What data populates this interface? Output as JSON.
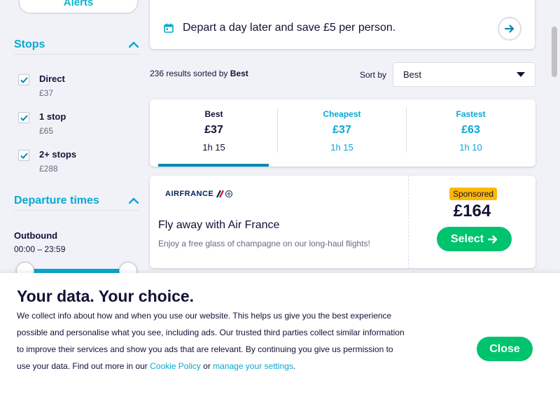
{
  "sidebar": {
    "alerts_label": "Alerts",
    "stops": {
      "heading": "Stops",
      "items": [
        {
          "label": "Direct",
          "price": "£37",
          "checked": true
        },
        {
          "label": "1 stop",
          "price": "£65",
          "checked": true
        },
        {
          "label": "2+ stops",
          "price": "£288",
          "checked": true
        }
      ]
    },
    "departure": {
      "heading": "Departure times",
      "outbound_label": "Outbound",
      "outbound_range": "00:00 – 23:59",
      "slider_range_fraction": [
        0,
        1
      ]
    }
  },
  "tip": {
    "text": "Depart a day later and save £5 per person."
  },
  "results": {
    "count_text": "236 results sorted by",
    "sorted_by": "Best",
    "sort_label": "Sort by",
    "sort_value": "Best"
  },
  "tabs": [
    {
      "name": "Best",
      "price": "£37",
      "duration": "1h 15",
      "active": true
    },
    {
      "name": "Cheapest",
      "price": "£37",
      "duration": "1h 15",
      "active": false
    },
    {
      "name": "Fastest",
      "price": "£63",
      "duration": "1h 10",
      "active": false
    }
  ],
  "ad": {
    "logo_text": "AIRFRANCE",
    "title": "Fly away with Air France",
    "subtitle": "Enjoy a free glass of champagne on our long-haul flights!",
    "badge": "Sponsored",
    "price": "£164",
    "select_label": "Select"
  },
  "consent": {
    "title": "Your data. Your choice.",
    "text_before": "We collect info about how and when you use our website. This helps us give you the best experience possible and personalise what you see, including ads. Our trusted third parties collect similar information to improve their services and show you ads that are relevant. By continuing you give us permission to use your data. Find out more in our ",
    "cookie_link": "Cookie Policy",
    "text_middle": " or ",
    "settings_link": "manage your settings",
    "text_after": ".",
    "close_label": "Close"
  },
  "colors": {
    "accent": "#0aa8d1",
    "green": "#00c36e",
    "sponsored": "#feb806",
    "text": "#111236"
  }
}
